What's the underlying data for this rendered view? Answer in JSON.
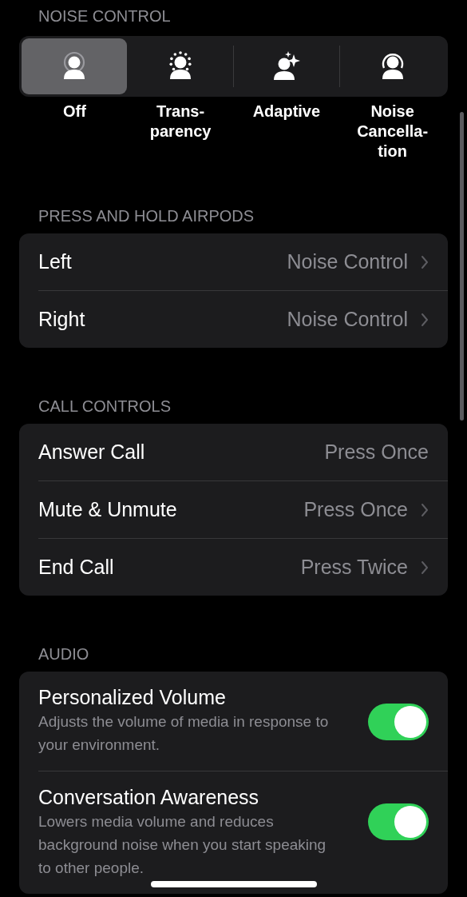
{
  "noise_control": {
    "header": "NOISE CONTROL",
    "modes": [
      {
        "kind": "off",
        "label": "Off",
        "selected": true
      },
      {
        "kind": "transparency",
        "label": "Trans-\nparency",
        "selected": false
      },
      {
        "kind": "adaptive",
        "label": "Adaptive",
        "selected": false
      },
      {
        "kind": "cancellation",
        "label": "Noise\nCancella-\ntion",
        "selected": false
      }
    ]
  },
  "sections": [
    {
      "header": "PRESS AND HOLD AIRPODS",
      "rows": [
        {
          "kind": "value",
          "label": "Left",
          "value": "Noise Control",
          "chevron": true
        },
        {
          "kind": "value",
          "label": "Right",
          "value": "Noise Control",
          "chevron": true
        }
      ]
    },
    {
      "header": "CALL CONTROLS",
      "rows": [
        {
          "kind": "value",
          "label": "Answer Call",
          "value": "Press Once",
          "chevron": false
        },
        {
          "kind": "value",
          "label": "Mute & Unmute",
          "value": "Press Once",
          "chevron": true
        },
        {
          "kind": "value",
          "label": "End Call",
          "value": "Press Twice",
          "chevron": true
        }
      ]
    },
    {
      "header": "AUDIO",
      "rows": [
        {
          "kind": "toggle",
          "label": "Personalized Volume",
          "description": "Adjusts the volume of media in response to your environment.",
          "on": true
        },
        {
          "kind": "toggle",
          "label": "Conversation Awareness",
          "description": "Lowers media volume and reduces background noise when you start speaking to other people.",
          "on": true
        }
      ]
    }
  ]
}
